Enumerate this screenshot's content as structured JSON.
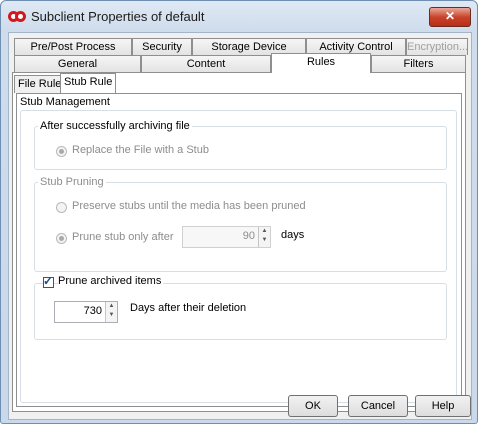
{
  "window": {
    "title": "Subclient Properties of default",
    "close_glyph": "✕",
    "icon": "dual-circle-app-icon"
  },
  "tabs_row1": [
    "Pre/Post Process",
    "Security",
    "Storage Device",
    "Activity Control",
    "Encryption..."
  ],
  "tabs_row2": [
    "General",
    "Content",
    "Rules",
    "Filters"
  ],
  "subtabs": [
    "File Rule",
    "Stub Rule"
  ],
  "stub_management": {
    "legend": "Stub Management",
    "after_archive": {
      "legend": "After successfully archiving file",
      "replace_label": "Replace the File with a Stub"
    },
    "pruning": {
      "legend": "Stub Pruning",
      "preserve_label": "Preserve stubs until the media has been pruned",
      "prune_label": "Prune stub only after",
      "prune_days_value": "90",
      "days_label": "days"
    },
    "archived": {
      "checkbox_label": "Prune archived items",
      "days_value": "730",
      "days_after_label": "Days after their deletion"
    }
  },
  "buttons": {
    "ok": "OK",
    "cancel": "Cancel",
    "help": "Help"
  },
  "colors": {
    "titlebar": "#dfe9f5",
    "close": "#c9442c",
    "app_icon": "#d2181f"
  }
}
